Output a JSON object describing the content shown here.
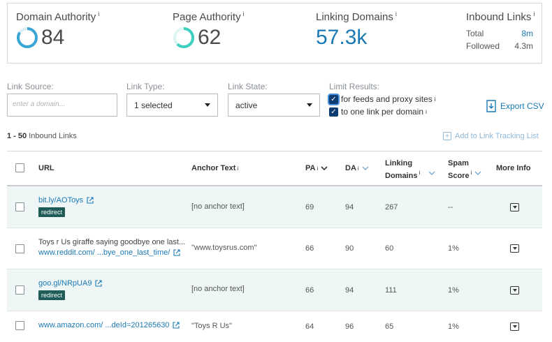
{
  "metrics": {
    "domain_authority": {
      "title": "Domain Authority",
      "info": "i",
      "value": "84",
      "ring_fraction": 0.84,
      "ring_color": "#3aa6d6"
    },
    "page_authority": {
      "title": "Page Authority",
      "info": "i",
      "value": "62",
      "ring_fraction": 0.62,
      "ring_color": "#3fcfc0"
    },
    "linking_domains": {
      "title": "Linking Domains",
      "info": "i",
      "value": "57.3k"
    },
    "inbound_links": {
      "title": "Inbound Links",
      "info": "i",
      "total_label": "Total",
      "total_value": "8m",
      "followed_label": "Followed",
      "followed_value": "4.3m"
    }
  },
  "filters": {
    "link_source": {
      "label": "Link Source:",
      "placeholder": "enter a domain..."
    },
    "link_type": {
      "label": "Link Type:",
      "value": "1 selected"
    },
    "link_state": {
      "label": "Link State:",
      "value": "active"
    },
    "limit_results": {
      "label": "Limit Results:",
      "options": [
        {
          "label": "for feeds and proxy sites",
          "info": "i",
          "checked": true
        },
        {
          "label": "to one link per domain",
          "info": "i",
          "checked": true
        }
      ]
    }
  },
  "export_label": "Export CSV",
  "range": {
    "bold": "1 - 50",
    "text": "Inbound Links"
  },
  "add_tracking_label": "Add to Link Tracking List",
  "table": {
    "headers": {
      "url": "URL",
      "anchor": "Anchor Text",
      "pa": "PA",
      "da": "DA",
      "linking_1": "Linking",
      "linking_2": "Domains",
      "spam_1": "Spam",
      "spam_2": "Score",
      "more": "More Info",
      "info": "i"
    },
    "rows": [
      {
        "title": "",
        "url": "bit.ly/AOToys",
        "badge": "redirect",
        "anchor": "[no anchor text]",
        "pa": "69",
        "da": "94",
        "linking": "267",
        "spam": "--"
      },
      {
        "title": "Toys r Us giraffe saying goodbye one last...",
        "url": "www.reddit.com/ ...bye_one_last_time/",
        "badge": "",
        "anchor": "\"www.toysrus.com\"",
        "pa": "66",
        "da": "90",
        "linking": "60",
        "spam": "1%"
      },
      {
        "title": "",
        "url": "goo.gl/NRpUA9",
        "badge": "redirect",
        "anchor": "[no anchor text]",
        "pa": "66",
        "da": "94",
        "linking": "111",
        "spam": "1%"
      },
      {
        "title": "",
        "url": "www.amazon.com/ ...deId=201265630",
        "badge": "",
        "anchor": "\"Toys R Us\"",
        "pa": "64",
        "da": "96",
        "linking": "65",
        "spam": "1%"
      }
    ]
  }
}
